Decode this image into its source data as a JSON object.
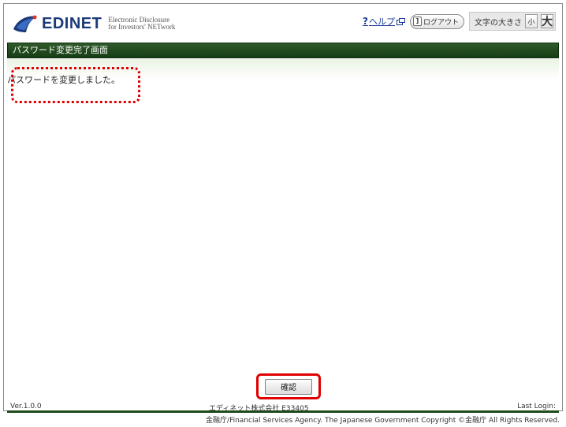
{
  "header": {
    "logo_text": "EDINET",
    "logo_sub_line1": "Electronic Disclosure",
    "logo_sub_line2": "for Investors' NETwork",
    "help_label": "ヘルプ",
    "logout_label": "ログアウト",
    "fontsize_label": "文字の大きさ",
    "fontsize_small": "小",
    "fontsize_large": "大"
  },
  "page": {
    "title": "パスワード変更完了画面",
    "message": "パスワードを変更しました。",
    "confirm_label": "確認"
  },
  "footer": {
    "version": "Ver.1.0.0",
    "company": "エディネット株式会社 E33405",
    "last_login": "Last Login:",
    "copyright": "金融庁/Financial Services Agency. The Japanese Government Copyright ©金融庁 All Rights Reserved."
  },
  "colors": {
    "brand_blue": "#1a3a7a",
    "title_green": "#1e4a1b",
    "highlight_red": "#e00000"
  }
}
